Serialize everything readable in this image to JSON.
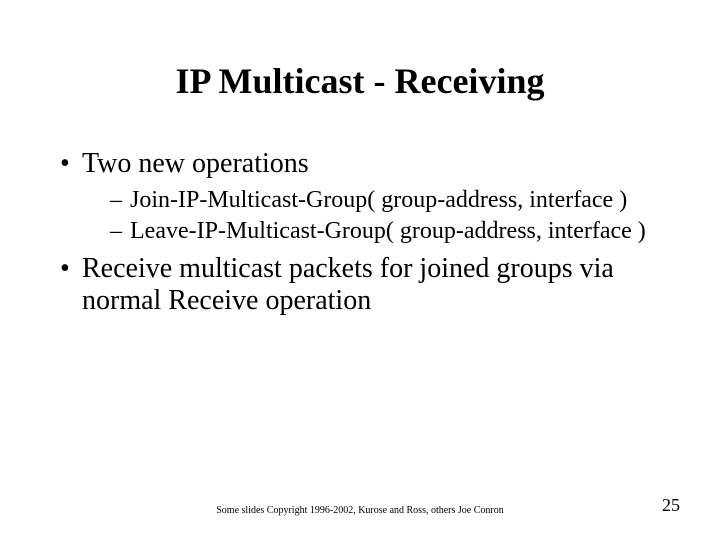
{
  "title": "IP Multicast - Receiving",
  "bullets": {
    "b1": "Two new operations",
    "b1_sub1": "Join-IP-Multicast-Group( group-address, interface )",
    "b1_sub2": "Leave-IP-Multicast-Group( group-address, interface )",
    "b2": "Receive multicast packets for joined groups via normal Receive operation"
  },
  "footer": "Some slides Copyright 1996-2002, Kurose and Ross, others Joe Conron",
  "page_number": "25"
}
